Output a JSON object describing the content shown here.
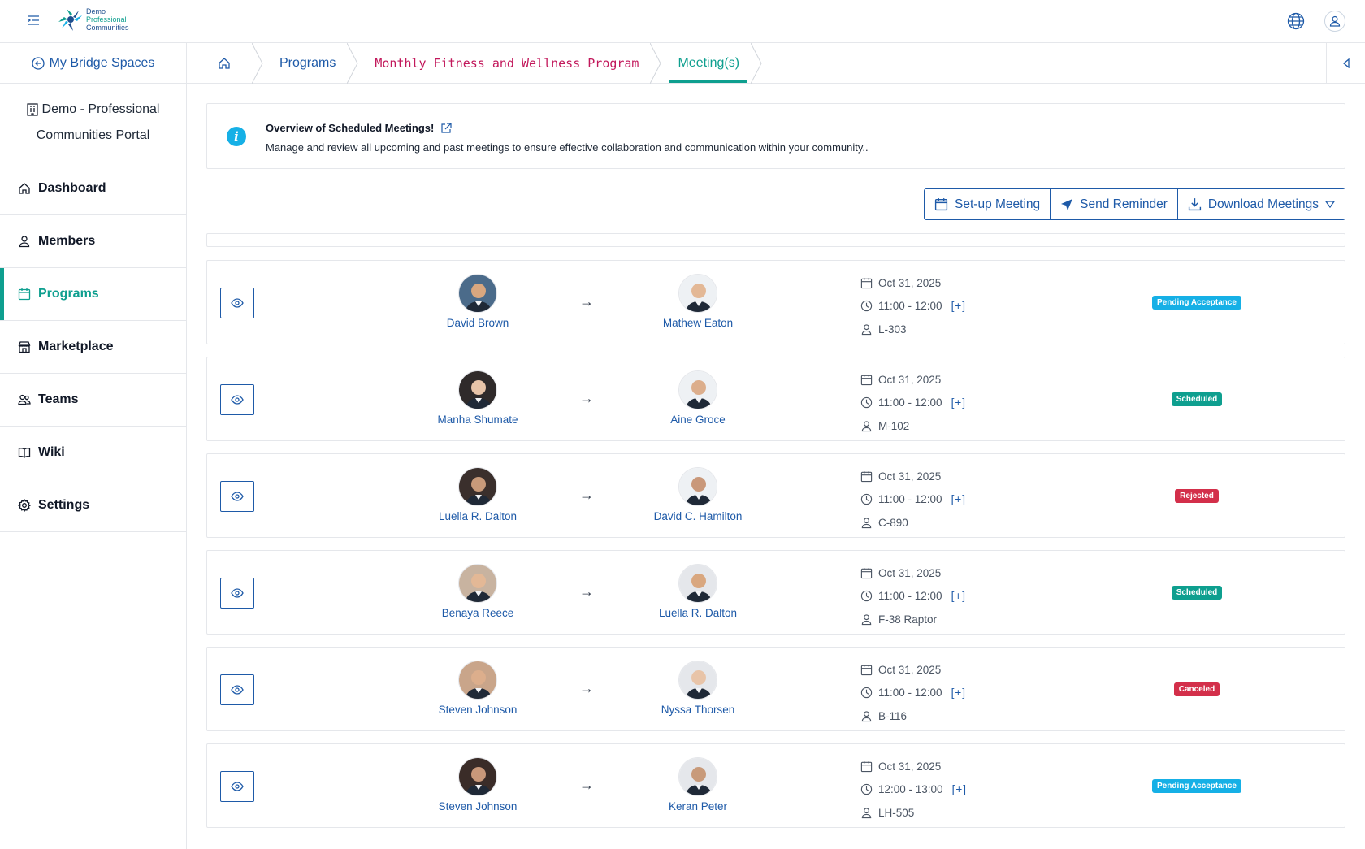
{
  "header": {
    "logo_line1": "Demo",
    "logo_line2": "Professional",
    "logo_line3": "Communities"
  },
  "sidebar": {
    "back_label": "My Bridge Spaces",
    "portal_line1": "Demo - Professional",
    "portal_line2": "Communities Portal",
    "items": [
      {
        "label": "Dashboard",
        "icon": "home-icon"
      },
      {
        "label": "Members",
        "icon": "user-icon"
      },
      {
        "label": "Programs",
        "icon": "calendar-icon",
        "active": true
      },
      {
        "label": "Marketplace",
        "icon": "store-icon"
      },
      {
        "label": "Teams",
        "icon": "users-icon"
      },
      {
        "label": "Wiki",
        "icon": "book-icon"
      },
      {
        "label": "Settings",
        "icon": "gear-icon"
      }
    ]
  },
  "breadcrumb": {
    "programs": "Programs",
    "program": "Monthly Fitness and Wellness Program",
    "meetings": "Meeting(s)"
  },
  "info": {
    "title": "Overview of Scheduled Meetings!",
    "description": "Manage and review all upcoming and past meetings to ensure effective collaboration and communication within your community.."
  },
  "toolbar": {
    "setup": "Set-up Meeting",
    "reminder": "Send Reminder",
    "download": "Download Meetings"
  },
  "colors": {
    "primary": "#1e5aa8",
    "accent": "#0e9f8f",
    "pending": "#16b0e6",
    "scheduled": "#0e9f8f",
    "rejected": "#d32f4a",
    "canceled": "#d32f4a"
  },
  "meetings": [
    {
      "from": "David Brown",
      "to": "Mathew Eaton",
      "date": "Oct 31, 2025",
      "time": "11:00 - 12:00",
      "plus": "[+]",
      "room": "L-303",
      "status": "Pending Acceptance",
      "status_color": "#16b0e6"
    },
    {
      "from": "Manha Shumate",
      "to": "Aine Groce",
      "date": "Oct 31, 2025",
      "time": "11:00 - 12:00",
      "plus": "[+]",
      "room": "M-102",
      "status": "Scheduled",
      "status_color": "#0e9f8f"
    },
    {
      "from": "Luella R. Dalton",
      "to": "David C. Hamilton",
      "date": "Oct 31, 2025",
      "time": "11:00 - 12:00",
      "plus": "[+]",
      "room": "C-890",
      "status": "Rejected",
      "status_color": "#d32f4a"
    },
    {
      "from": "Benaya Reece",
      "to": "Luella R. Dalton",
      "date": "Oct 31, 2025",
      "time": "11:00 - 12:00",
      "plus": "[+]",
      "room": "F-38 Raptor",
      "status": "Scheduled",
      "status_color": "#0e9f8f"
    },
    {
      "from": "Steven Johnson",
      "to": "Nyssa Thorsen",
      "date": "Oct 31, 2025",
      "time": "11:00 - 12:00",
      "plus": "[+]",
      "room": "B-116",
      "status": "Canceled",
      "status_color": "#d32f4a"
    },
    {
      "from": "Steven Johnson",
      "to": "Keran Peter",
      "date": "Oct 31, 2025",
      "time": "12:00 - 13:00",
      "plus": "[+]",
      "room": "LH-505",
      "status": "Pending Acceptance",
      "status_color": "#16b0e6"
    }
  ]
}
